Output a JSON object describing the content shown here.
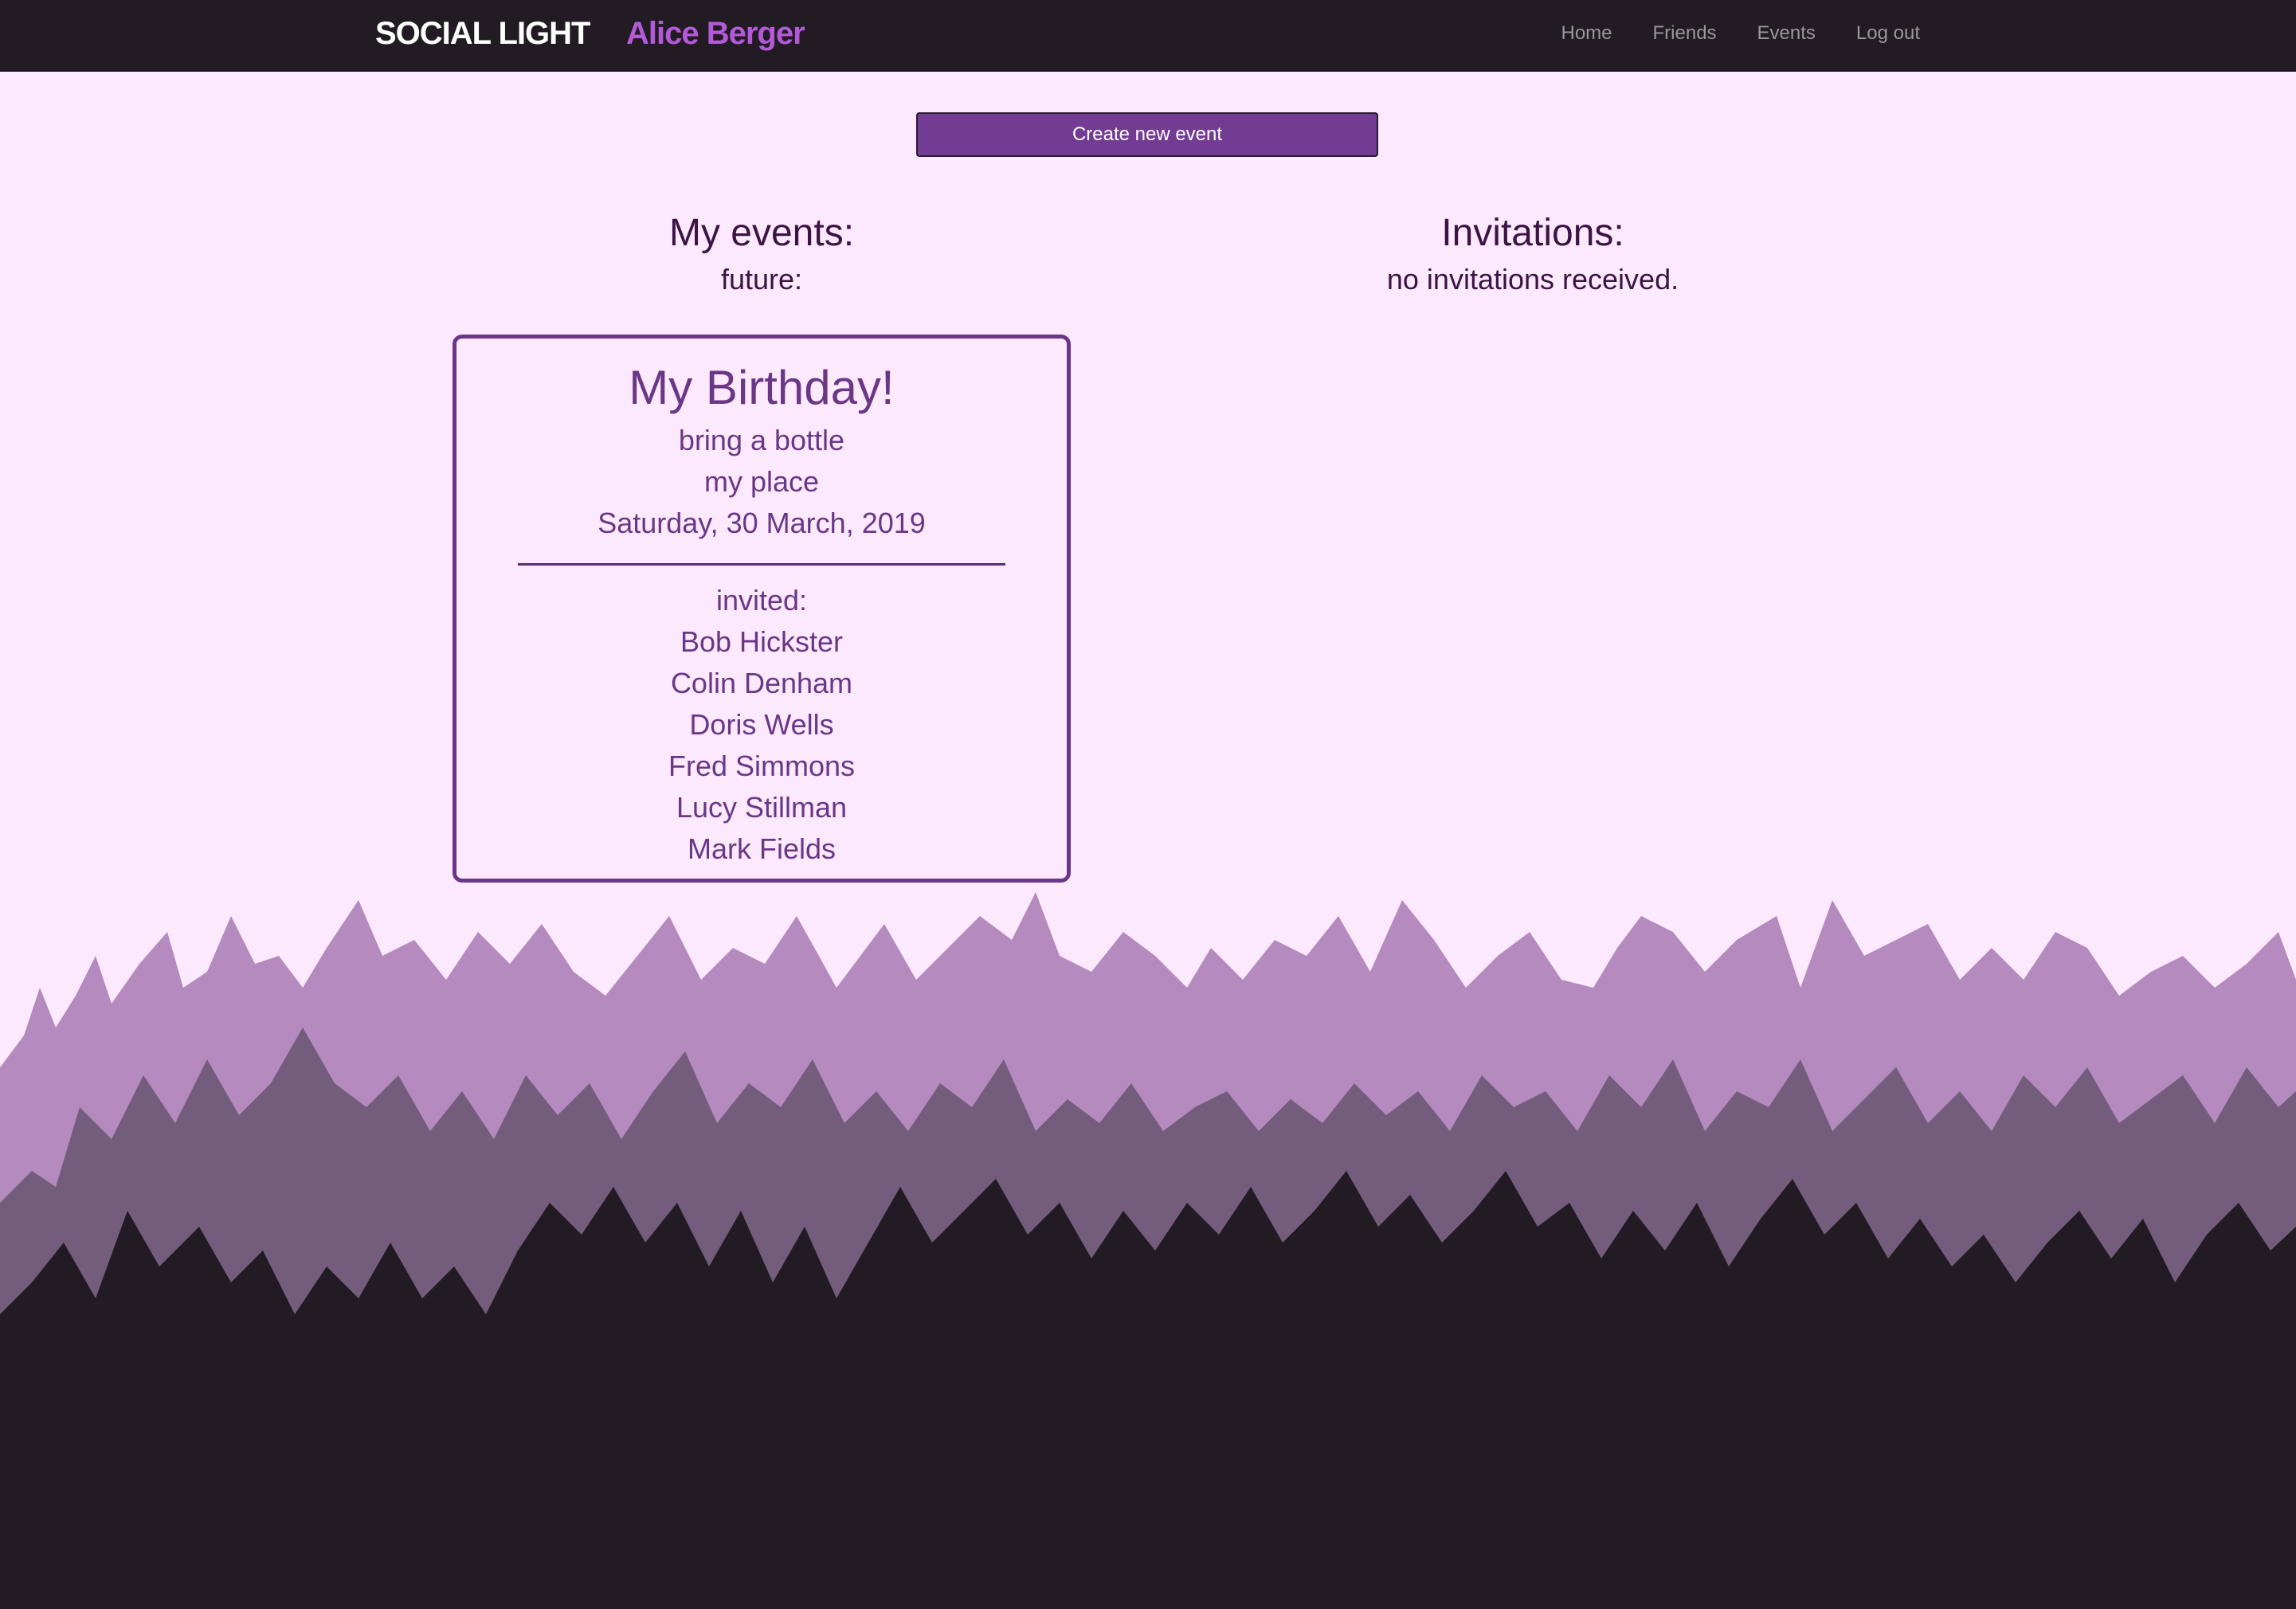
{
  "header": {
    "brand": "SOCIAL LIGHT",
    "user_name": "Alice Berger",
    "nav": [
      {
        "label": "Home"
      },
      {
        "label": "Friends"
      },
      {
        "label": "Events"
      },
      {
        "label": "Log out"
      }
    ]
  },
  "actions": {
    "create_event_label": "Create new event"
  },
  "my_events": {
    "heading": "My events:",
    "subheading": "future:",
    "events": [
      {
        "title": "My Birthday!",
        "description": "bring a bottle",
        "location": "my place",
        "date": "Saturday, 30 March, 2019",
        "invited_label": "invited:",
        "invited": [
          "Bob Hickster",
          "Colin Denham",
          "Doris Wells",
          "Fred Simmons",
          "Lucy Stillman",
          "Mark Fields"
        ]
      }
    ]
  },
  "invitations": {
    "heading": "Invitations:",
    "empty_text": "no invitations received."
  },
  "colors": {
    "background": "#fde9fd",
    "navbar": "#231b24",
    "accent": "#733c93",
    "user_name": "#b35ad8",
    "card_text": "#6a3787",
    "heading_text": "#3b1444",
    "crowd_back": "#b48abf",
    "crowd_mid": "#745c7c",
    "crowd_front": "#231b24"
  },
  "decoration": {
    "background_image": "crowd-silhouette-illustration"
  }
}
